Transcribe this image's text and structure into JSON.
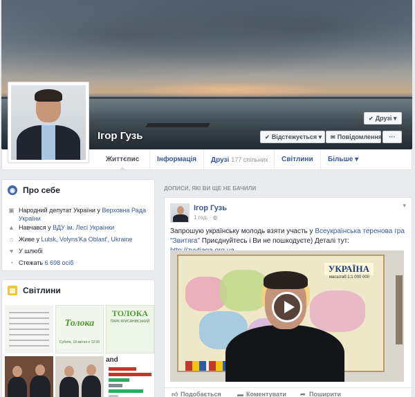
{
  "profile": {
    "name": "Ігор Гузь",
    "buttons": {
      "friends": "Друзі",
      "follow": "Відстежується",
      "message": "Повідомлення",
      "more": "···"
    }
  },
  "tabs": [
    {
      "label": "Життєпис",
      "active": true
    },
    {
      "label": "Інформація"
    },
    {
      "label": "Друзі",
      "count": "177 спільних"
    },
    {
      "label": "Світлини"
    },
    {
      "label": "Більше"
    }
  ],
  "about": {
    "title": "Про себе",
    "work_prefix": "Народний депутат України у ",
    "work_link": "Верховна Рада України",
    "study_prefix": "Навчався у ",
    "study_link": "ВДУ ім. Лесі Українки",
    "lives_prefix": "Живе у ",
    "lives_link": "Lutsk, Volyns'Ka Oblast', Ukraine",
    "relationship": "У шлюбі",
    "followers_prefix": "Стежать ",
    "followers_link": "6 698 осіб"
  },
  "photos": {
    "title": "Світлини",
    "thumb2_title": "Толока",
    "thumb2_sub": "Субота, 18 квітня о 12:00",
    "thumb3_title": "ТОЛОКА",
    "thumb3_sub": "ПАРК КРИСАНІВСЬКИЙ",
    "thumb6_word": "and"
  },
  "feed": {
    "section_label": "ДОПИСИ, ЯКІ ВИ ЩЕ НЕ БАЧИЛИ",
    "post": {
      "author": "Ігор Гузь",
      "time": "1 год.",
      "text_1": "Запрошую українську молодь взяти участь у ",
      "text_link1": "Всеукраїнська теренова гра \"Звитяга\"",
      "text_2": " Приєднуйтесь і Ви не пошкодуєте) Деталі тут: ",
      "text_link2": "http://zvytjaga.org.ua",
      "video_map_title": "УКРАЇНА",
      "video_map_scale": "масштаб 1:1 000 000",
      "actions": {
        "like": "Подобається",
        "comment": "Коментувати",
        "share": "Поширити"
      }
    }
  },
  "colors": {
    "link": "#365899",
    "bg": "#e9ebee",
    "card_border": "#dddfe2"
  }
}
